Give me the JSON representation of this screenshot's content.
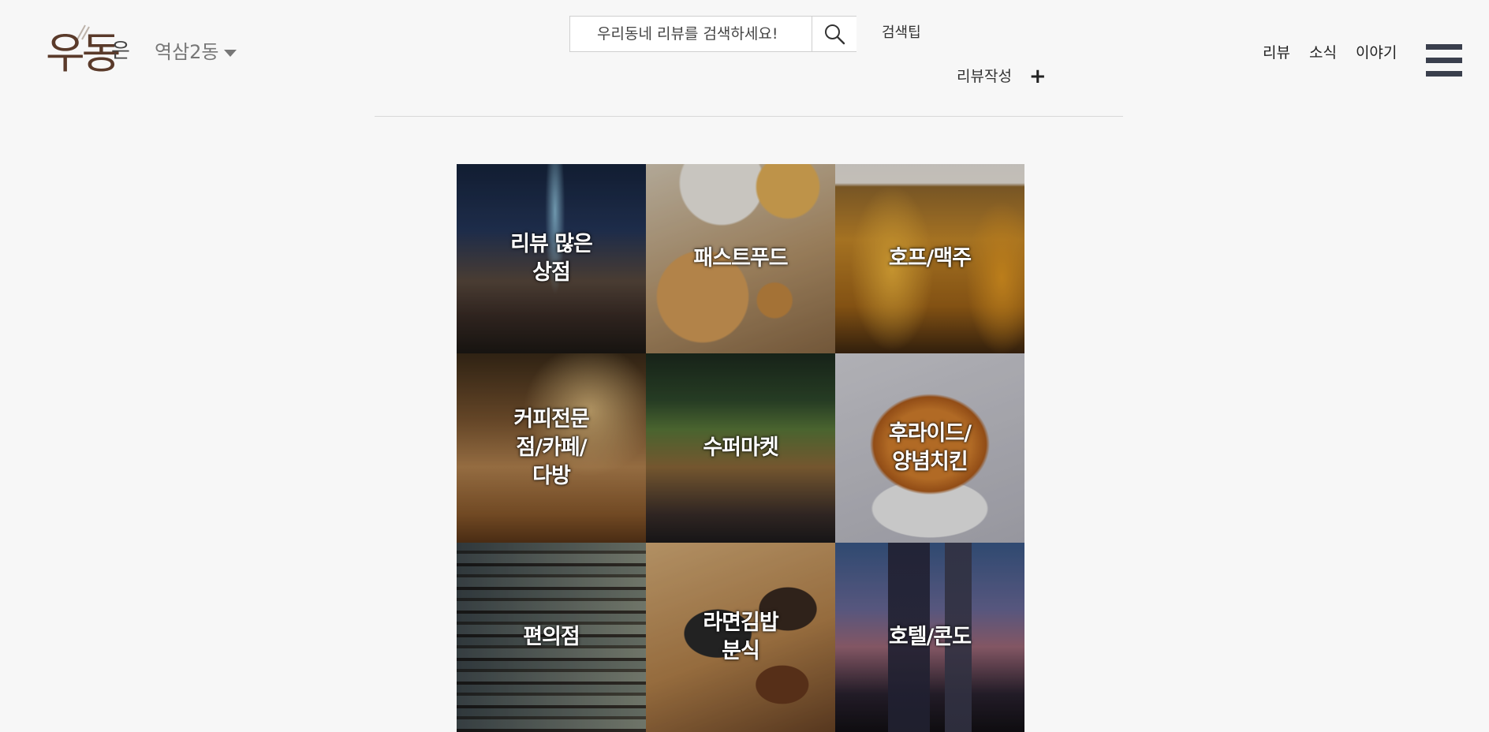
{
  "header": {
    "logo_text": "우동",
    "logo_suffix": "은",
    "location": "역삼2동",
    "search_placeholder": "우리동네 리뷰를 검색하세요!",
    "search_tip": "검색팁",
    "write_review": "리뷰작성",
    "write_review_icon": "+",
    "nav": [
      "리뷰",
      "소식",
      "이야기"
    ]
  },
  "categories": [
    {
      "label": "리뷰 많은\n상점",
      "image": "busy-street-crowd-photo"
    },
    {
      "label": "패스트푸드",
      "image": "pizza-snacks-photo"
    },
    {
      "label": "호프/맥주",
      "image": "beer-mugs-photo"
    },
    {
      "label": "커피전문\n점/카페/\n다방",
      "image": "cafe-interior-photo"
    },
    {
      "label": "수퍼마켓",
      "image": "supermarket-aisle-photo"
    },
    {
      "label": "후라이드/\n양념치킨",
      "image": "fried-chicken-photo"
    },
    {
      "label": "편의점",
      "image": "convenience-store-photo"
    },
    {
      "label": "라면김밥\n분식",
      "image": "ramen-bowls-photo"
    },
    {
      "label": "호텔/콘도",
      "image": "hotel-night-photo"
    }
  ],
  "colors": {
    "background": "#f7f7f7",
    "logo": "#5a3a2a",
    "menu_icon": "#3a3f4d",
    "tile_text": "#ffffff"
  }
}
